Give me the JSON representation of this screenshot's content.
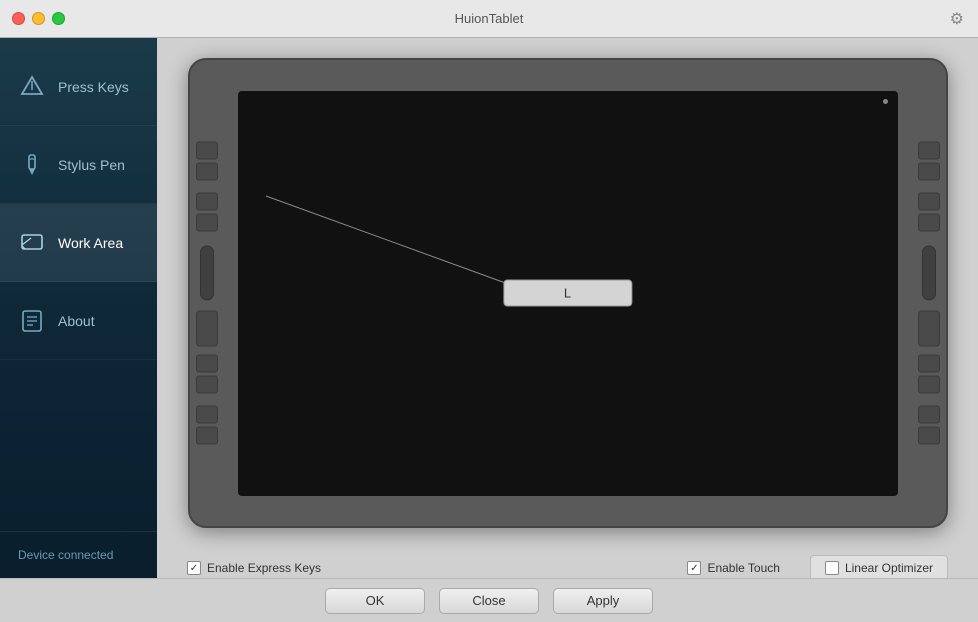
{
  "window": {
    "title": "HuionTablet"
  },
  "titlebar": {
    "close": "close",
    "minimize": "minimize",
    "maximize": "maximize",
    "gear_label": "⚙"
  },
  "sidebar": {
    "items": [
      {
        "id": "press-keys",
        "label": "Press Keys",
        "active": false
      },
      {
        "id": "stylus-pen",
        "label": "Stylus Pen",
        "active": false
      },
      {
        "id": "work-area",
        "label": "Work Area",
        "active": true
      },
      {
        "id": "about",
        "label": "About",
        "active": false
      }
    ],
    "footer": {
      "status": "Device connected"
    }
  },
  "tablet": {
    "screen_label": "L"
  },
  "checkboxes": {
    "express_keys": {
      "label": "Enable Express Keys",
      "checked": true
    },
    "touch": {
      "label": "Enable Touch",
      "checked": true
    },
    "linear_optimizer": {
      "label": "Linear Optimizer",
      "checked": false
    }
  },
  "buttons": {
    "ok": "OK",
    "close": "Close",
    "apply": "Apply"
  }
}
